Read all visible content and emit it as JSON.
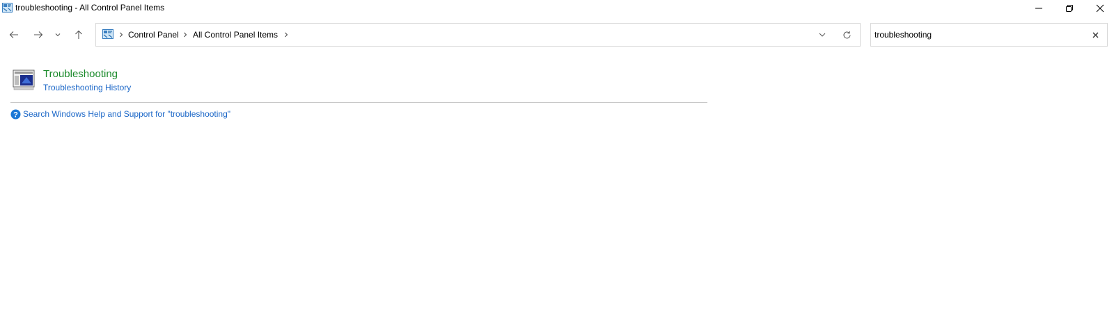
{
  "window": {
    "title": "troubleshooting - All Control Panel Items"
  },
  "nav": {
    "back_icon": "arrow-left-icon",
    "forward_icon": "arrow-right-icon",
    "recent_icon": "chevron-down-icon",
    "up_icon": "arrow-up-icon"
  },
  "address_bar": {
    "breadcrumbs": [
      "Control Panel",
      "All Control Panel Items"
    ]
  },
  "search": {
    "value": "troubleshooting"
  },
  "results": {
    "title": "Troubleshooting",
    "sub_link": "Troubleshooting History"
  },
  "help": {
    "link": "Search Windows Help and Support for \"troubleshooting\""
  },
  "colors": {
    "result_title": "#1a8a2a",
    "link": "#1a66c7",
    "border": "#d9d9d9"
  }
}
